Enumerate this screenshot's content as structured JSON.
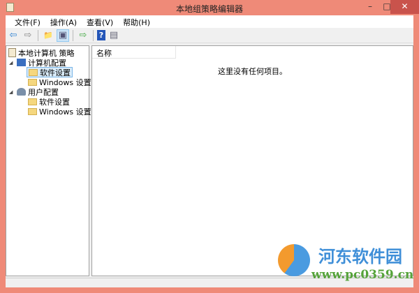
{
  "window": {
    "title": "本地组策略编辑器",
    "minimize": "–",
    "maximize": "□",
    "close": "✕"
  },
  "menu": [
    "文件(F)",
    "操作(A)",
    "查看(V)",
    "帮助(H)"
  ],
  "toolbar": {
    "back": "⇦",
    "forward": "⇨",
    "up": "📁",
    "show_tree": "▣",
    "export": "⇨",
    "help": "?",
    "properties": "▤"
  },
  "tree": {
    "root": "本地计算机 策略",
    "computer": "计算机配置",
    "computer_children": [
      "软件设置",
      "Windows 设置"
    ],
    "user": "用户配置",
    "user_children": [
      "软件设置",
      "Windows 设置"
    ]
  },
  "list": {
    "column": "名称",
    "empty": "这里没有任何项目。"
  },
  "watermark": {
    "name": "河东软件园",
    "url": "www.pc0359.cn"
  }
}
